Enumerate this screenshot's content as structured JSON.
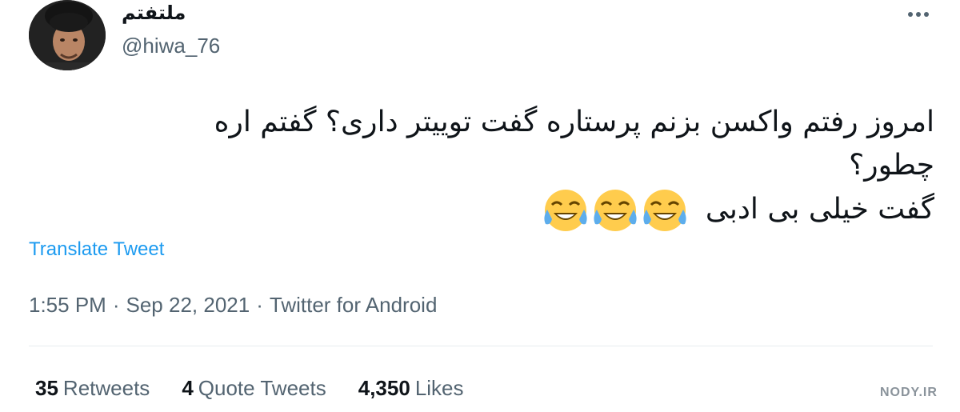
{
  "tweet": {
    "author": {
      "display_name": "ملتفتم",
      "handle": "@hiwa_76"
    },
    "text_lines": [
      "امروز رفتم واکسن بزنم پرستاره گفت توییتر داری؟ گفتم اره",
      "چطور؟",
      "گفت خیلی بی ادبی"
    ],
    "emojis": [
      "😂",
      "😂",
      "😂"
    ],
    "translate_label": "Translate Tweet",
    "time": "1:55 PM",
    "date": "Sep 22, 2021",
    "separator": "·",
    "source": "Twitter for Android",
    "stats": {
      "retweets_count": "35",
      "retweets_label": "Retweets",
      "quotes_count": "4",
      "quotes_label": "Quote Tweets",
      "likes_count": "4,350",
      "likes_label": "Likes"
    }
  },
  "icons": {
    "more": "more-horizontal-icon",
    "emoji": "face-with-tears-of-joy"
  },
  "watermark": "NODY.IR",
  "colors": {
    "text_primary": "#0f1419",
    "text_secondary": "#536471",
    "link": "#1d9bf0",
    "divider": "#e7ecf0",
    "background": "#ffffff"
  }
}
